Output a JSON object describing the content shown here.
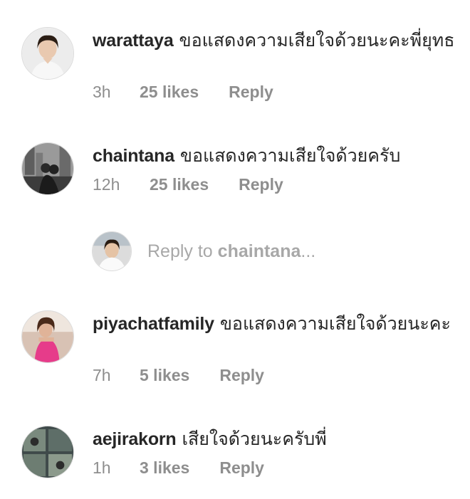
{
  "comments": [
    {
      "username": "warattaya",
      "text": "ขอแสดงความเสียใจด้วยนะคะพี่ยุทธ",
      "time": "3h",
      "likes": "25 likes",
      "reply": "Reply",
      "avatar_icon": "profile-photo-woman"
    },
    {
      "username": "chaintana",
      "text": "ขอแสดงความเสียใจด้วยครับ",
      "time": "12h",
      "likes": "25 likes",
      "reply": "Reply",
      "avatar_icon": "profile-photo-couple-city"
    },
    {
      "username": "piyachatfamily",
      "text": "ขอแสดงความเสียใจด้วยนะคะ",
      "time": "7h",
      "likes": "5 likes",
      "reply": "Reply",
      "avatar_icon": "profile-photo-woman-pink-dress"
    },
    {
      "username": "aejirakorn",
      "text": "เสียใจด้วยนะครับพี่",
      "time": "1h",
      "likes": "3 likes",
      "reply": "Reply",
      "avatar_icon": "profile-photo-collage"
    }
  ],
  "reply_prompt": {
    "prefix": "Reply to ",
    "target": "chaintana",
    "suffix": "...",
    "avatar_icon": "own-profile-photo"
  },
  "colors": {
    "text": "#262626",
    "secondary": "#8e8e8e",
    "placeholder": "#a8a8a8"
  }
}
